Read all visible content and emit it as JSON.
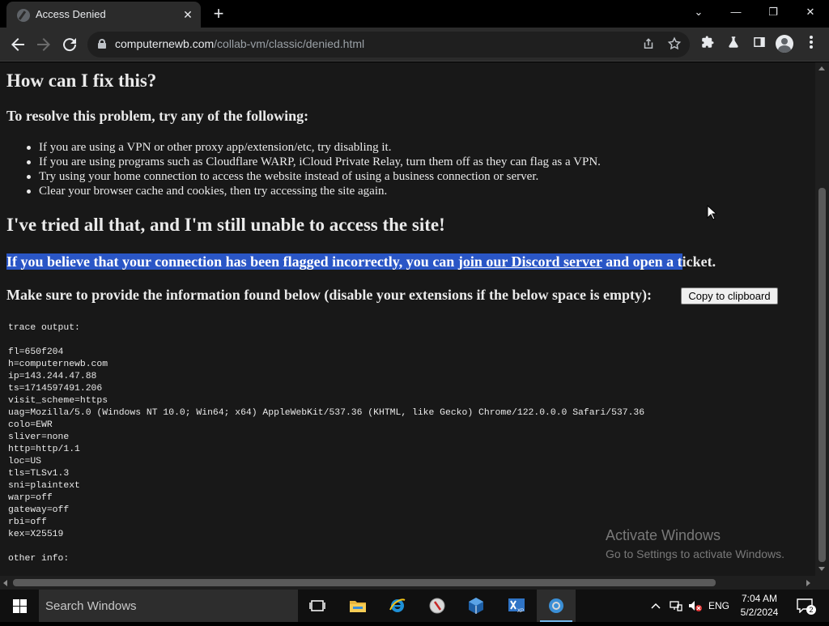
{
  "browser": {
    "tab_title": "Access Denied",
    "tab_close": "✕",
    "new_tab": "+",
    "url_host": "computernewb.com",
    "url_path": "/collab-vm/classic/denied.html",
    "window_minimize": "—",
    "window_restore": "❐",
    "window_close": "✕",
    "tab_search": "⌄"
  },
  "page": {
    "heading_fix": "How can I fix this?",
    "resolve_intro": "To resolve this problem, try any of the following:",
    "fix_steps": [
      "If you are using a VPN or other proxy app/extension/etc, try disabling it.",
      "If you are using programs such as Cloudflare WARP, iCloud Private Relay, turn them off as they can flag as a VPN.",
      "Try using your home connection to access the website instead of using a business connection or server.",
      "Clear your browser cache and cookies, then try accessing the site again."
    ],
    "heading_still_unable": "I've tried all that, and I'm still unable to access the site!",
    "flagged_text_before": "If you believe that your connection has been flagged incorrectly, you can ",
    "discord_link": "join our Discord server",
    "flagged_text_selected_tail": " and open a t",
    "flagged_text_after": "icket.",
    "provide_info": "Make sure to provide the information found below (disable your extensions if the below space is empty):",
    "copy_button": "Copy to clipboard",
    "trace_output": "trace output:\n\nfl=650f204\nh=computernewb.com\nip=143.244.47.88\nts=1714597491.206\nvisit_scheme=https\nuag=Mozilla/5.0 (Windows NT 10.0; Win64; x64) AppleWebKit/537.36 (KHTML, like Gecko) Chrome/122.0.0.0 Safari/537.36\ncolo=EWR\nsliver=none\nhttp=http/1.1\nloc=US\ntls=TLSv1.3\nsni=plaintext\nwarp=off\ngateway=off\nrbi=off\nkex=X25519\n\nother info:"
  },
  "watermark": {
    "title": "Activate Windows",
    "subtitle": "Go to Settings to activate Windows."
  },
  "taskbar": {
    "search_placeholder": "Search Windows",
    "language": "ENG",
    "time": "7:04 AM",
    "date": "5/2/2024",
    "notification_count": "2",
    "apps": [
      "task-view",
      "file-explorer",
      "internet-explorer",
      "media-app",
      "virtualbox",
      "xp-mode",
      "chrome"
    ]
  },
  "colors": {
    "selection": "#2a56c6",
    "page_bg": "#181818",
    "accent_taskbar": "#76b9ed"
  }
}
